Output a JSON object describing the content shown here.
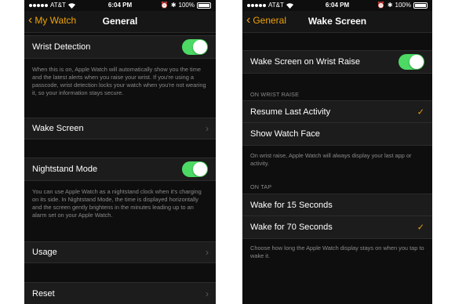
{
  "status": {
    "carrier": "AT&T",
    "time": "6:04 PM",
    "battery": "100%"
  },
  "general": {
    "back_label": "My Watch",
    "title": "General",
    "wrist_detection": {
      "label": "Wrist Detection",
      "on": true
    },
    "wrist_detection_desc": "When this is on, Apple Watch will automatically show you the time and the latest alerts when you raise your wrist. If you're using a passcode, wrist detection locks your watch when you're not wearing it, so your information stays secure.",
    "wake_screen_label": "Wake Screen",
    "nightstand_mode": {
      "label": "Nightstand Mode",
      "on": true
    },
    "nightstand_desc": "You can use Apple Watch as a nightstand clock when it's charging on its side. In Nightstand Mode, the time is displayed horizontally and the screen gently brightens in the minutes leading up to an alarm set on your Apple Watch.",
    "usage_label": "Usage",
    "reset_label": "Reset"
  },
  "wake_screen": {
    "back_label": "General",
    "title": "Wake Screen",
    "wrist_raise": {
      "label": "Wake Screen on Wrist Raise",
      "on": true
    },
    "section_wrist_raise": "ON WRIST RAISE",
    "options": [
      {
        "label": "Resume Last Activity",
        "selected": true
      },
      {
        "label": "Show Watch Face",
        "selected": false
      }
    ],
    "wrist_raise_desc": "On wrist raise, Apple Watch will always display your last app or activity.",
    "section_on_tap": "ON TAP",
    "tap_options": [
      {
        "label": "Wake for 15 Seconds",
        "selected": false
      },
      {
        "label": "Wake for 70 Seconds",
        "selected": true
      }
    ],
    "tap_desc": "Choose how long the Apple Watch display stays on when you tap to wake it."
  },
  "colors": {
    "accent": "#f0a30a",
    "toggle_on": "#4cd964",
    "background": "#0e0e0e",
    "cell": "#1c1c1c"
  },
  "icons": [
    "chevron-left-icon",
    "chevron-right-icon",
    "checkmark-icon",
    "wifi-icon",
    "alarm-icon",
    "bluetooth-icon",
    "battery-icon"
  ]
}
